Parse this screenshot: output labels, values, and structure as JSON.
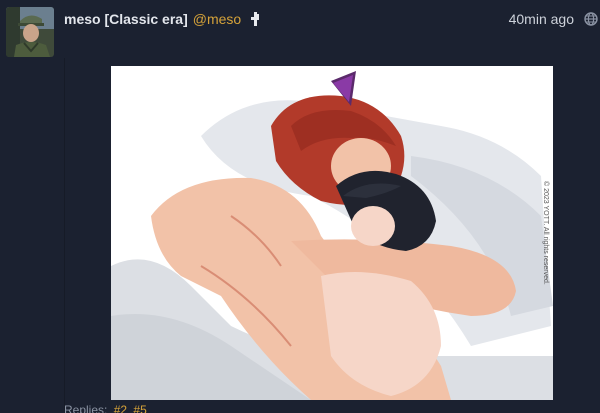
{
  "post": {
    "author": {
      "display_name": "meso [Classic era]",
      "handle": "@meso",
      "avatar_icon": "user-avatar"
    },
    "timestamp": "40min ago",
    "visibility_icon": "globe-icon",
    "bot_badge_icon": "pin-icon",
    "media": {
      "type": "illustration",
      "watermark": "© 2023 YOTT. All rights reserved."
    },
    "replies": {
      "label": "Replies:",
      "links": [
        "#2",
        "#5"
      ]
    }
  },
  "colors": {
    "background": "#1b2130",
    "accent": "#d6a33a",
    "text": "#e3e6ec",
    "muted": "#8b93a3"
  }
}
